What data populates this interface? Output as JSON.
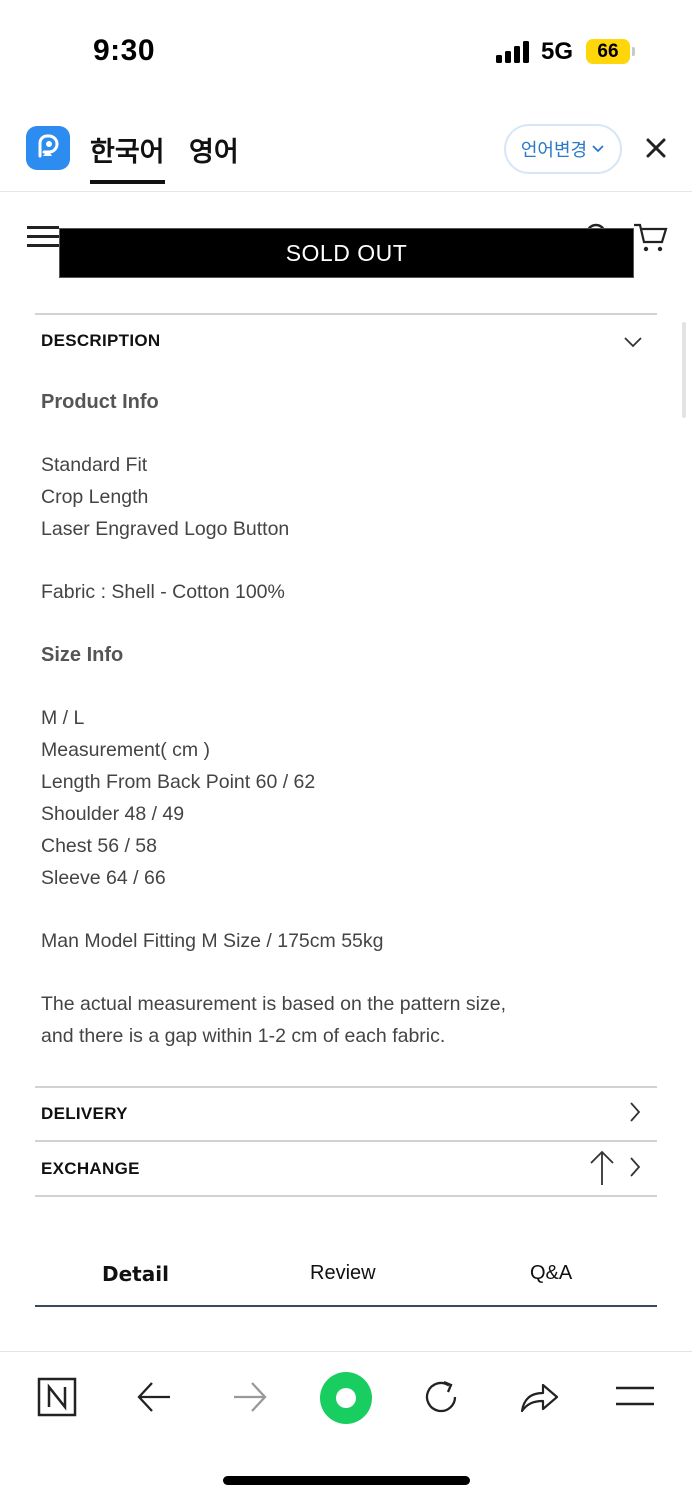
{
  "status_bar": {
    "time": "9:30",
    "network": "5G",
    "battery": "66"
  },
  "translate_bar": {
    "tabs": [
      {
        "label": "한국어",
        "active": true
      },
      {
        "label": "영어",
        "active": false
      }
    ],
    "change_language": "언어변경"
  },
  "header": {
    "sold_out": "SOLD OUT"
  },
  "description": {
    "heading": "DESCRIPTION",
    "product_info_title": "Product Info",
    "features": [
      "Standard Fit",
      "Crop Length",
      "Laser Engraved Logo Button"
    ],
    "fabric": "Fabric : Shell - Cotton 100%",
    "size_info_title": "Size Info",
    "size_lines": [
      "M / L",
      "Measurement( cm )",
      "Length From Back Point 60 / 62",
      "Shoulder 48 / 49",
      "Chest 56 / 58",
      "Sleeve 64 / 66"
    ],
    "model_fitting": "Man Model Fitting M Size / 175cm 55kg",
    "note_lines": [
      "The actual measurement is based on the pattern size,",
      "and there is a gap within 1-2 cm of each fabric."
    ]
  },
  "sections": {
    "delivery": "DELIVERY",
    "exchange": "EXCHANGE"
  },
  "tabs": {
    "detail": "Detail",
    "review": "Review",
    "qa": "Q&A"
  },
  "colors": {
    "sold_out_bg": "#000000",
    "accent_blue": "#2d8cf0",
    "green_button": "#19ce60",
    "battery": "#ffd60a"
  }
}
